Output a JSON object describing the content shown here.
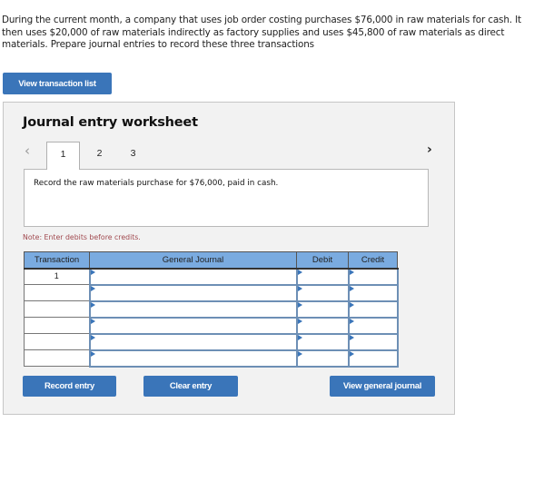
{
  "intro_text": "During the current month, a company that uses job order costing purchases $76,000 in raw materials for cash. It then uses $20,000 of raw materials indirectly as factory supplies and uses $45,800 of raw materials as direct materials. Prepare journal entries to record these three transactions",
  "view_transaction_list_label": "View transaction list",
  "worksheet": {
    "title": "Journal entry worksheet",
    "prev_icon": "‹",
    "next_icon": "›",
    "tabs": [
      {
        "label": "1",
        "active": true
      },
      {
        "label": "2",
        "active": false
      },
      {
        "label": "3",
        "active": false
      }
    ],
    "description": "Record the raw materials purchase for $76,000, paid in cash.",
    "note": "Note: Enter debits before credits.",
    "table": {
      "headers": [
        "Transaction",
        "General Journal",
        "Debit",
        "Credit"
      ],
      "rows": [
        {
          "transaction": "1",
          "account": "",
          "debit": "",
          "credit": ""
        },
        {
          "transaction": "",
          "account": "",
          "debit": "",
          "credit": ""
        },
        {
          "transaction": "",
          "account": "",
          "debit": "",
          "credit": ""
        },
        {
          "transaction": "",
          "account": "",
          "debit": "",
          "credit": ""
        },
        {
          "transaction": "",
          "account": "",
          "debit": "",
          "credit": ""
        },
        {
          "transaction": "",
          "account": "",
          "debit": "",
          "credit": ""
        }
      ]
    },
    "buttons": {
      "record": "Record entry",
      "clear": "Clear entry",
      "view_general_journal": "View general journal"
    }
  },
  "colors": {
    "button_blue": "#3a75b9",
    "header_blue": "#7aabe0",
    "note_red": "#a0484e"
  }
}
